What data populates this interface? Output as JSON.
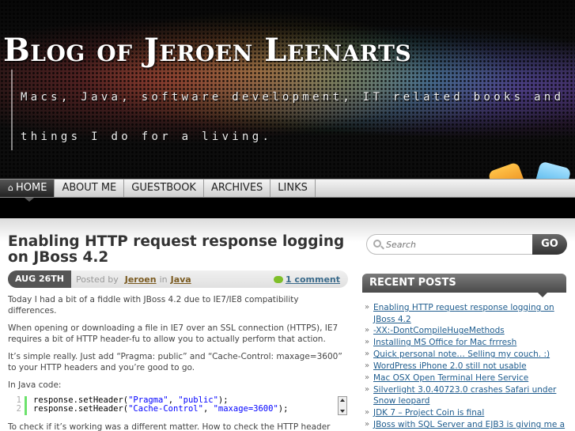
{
  "header": {
    "site_title": "Blog of Jeroen Leenarts",
    "tagline": "Macs, Java, software development, IT related books and things I do for a living."
  },
  "nav": {
    "items": [
      {
        "label": "HOME",
        "icon": "home-icon",
        "active": true
      },
      {
        "label": "ABOUT ME"
      },
      {
        "label": "GUESTBOOK"
      },
      {
        "label": "ARCHIVES"
      },
      {
        "label": "LINKS"
      }
    ]
  },
  "post": {
    "title": "Enabling HTTP request response logging on JBoss 4.2",
    "date": "AUG 26TH",
    "posted_by_prefix": "Posted by",
    "author": "Jeroen",
    "in_word": "in",
    "category": "Java",
    "comments": "1 comment",
    "paragraphs": [
      "Today I had a bit of a fiddle with JBoss 4.2 due to IE7/IE8 compatibility differences.",
      "When opening or downloading a file in IE7 over an SSL connection (HTTPS), IE7 requires a bit of HTTP header-fu to allow you to actually perform that action.",
      "It’s simple really. Just add “Pragma: public” and “Cache-Control: maxage=3600” to your HTTP headers and you’re good to go.",
      "In Java code:"
    ],
    "code": {
      "line_numbers": [
        "1",
        "2"
      ],
      "line1_pre": "response.setHeader(",
      "line1_arg1": "\"Pragma\"",
      "line1_sep": ", ",
      "line1_arg2": "\"public\"",
      "line1_post": ");",
      "line2_pre": "response.setHeader(",
      "line2_arg1": "\"Cache-Control\"",
      "line2_sep": ", ",
      "line2_arg2": "\"maxage=3600\"",
      "line2_post": ");"
    },
    "after_code": "To check if it’s working was a different matter. How to check the HTTP header content"
  },
  "sidebar": {
    "search_placeholder": "Search",
    "search_button": "GO",
    "recent_title": "RECENT POSTS",
    "recent_posts": [
      "Enabling HTTP request response logging on JBoss 4.2",
      "-XX:-DontCompileHugeMethods",
      "Installing MS Office for Mac frrresh",
      "Quick personal note… Selling my couch. :)",
      "WordPress iPhone 2.0 still not usable",
      "Mac OSX Open Terminal Here Service",
      "Silverlight 3.0.40723.0 crashes Safari under Snow leopard",
      "JDK 7 – Project Coin is final",
      "JBoss with SQL Server and EJB3 is giving me a"
    ]
  },
  "colors": {
    "header_bg": "#111111",
    "nav_active": "#333333",
    "link": "#1e5c8e",
    "code_gutter": "#6ce26c"
  }
}
